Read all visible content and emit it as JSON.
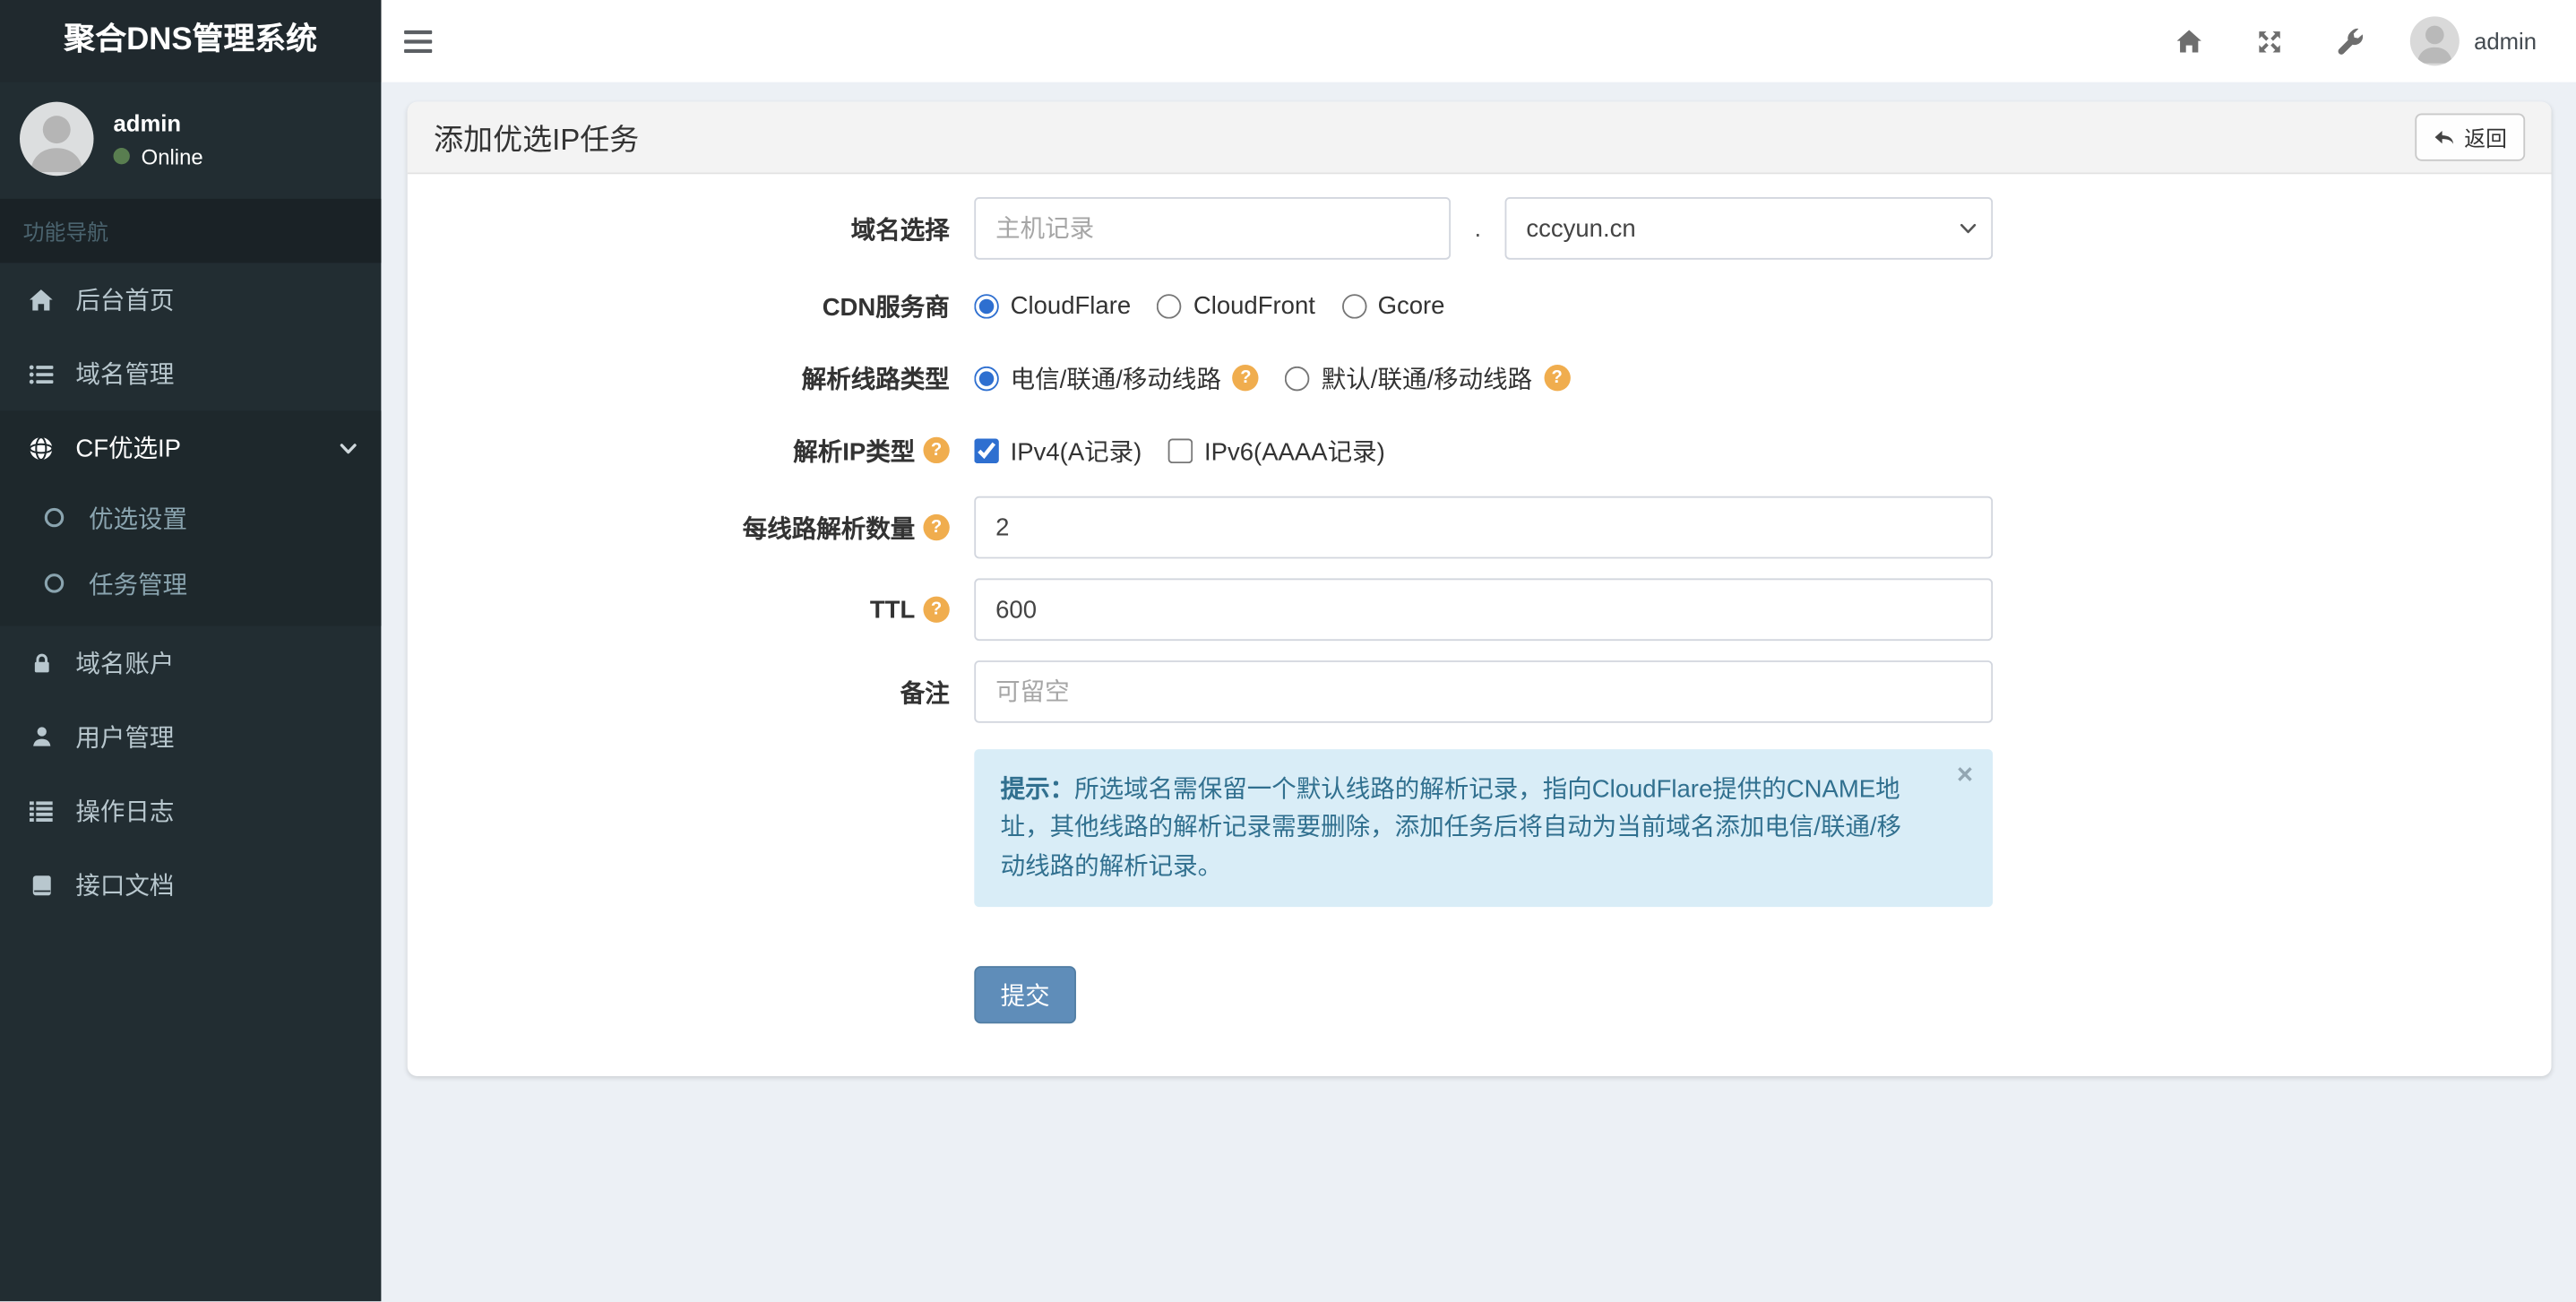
{
  "app": {
    "brand": "聚合DNS管理系统"
  },
  "user_panel": {
    "name": "admin",
    "status": "Online"
  },
  "navbar": {
    "username": "admin"
  },
  "sidebar": {
    "section_header": "功能导航",
    "menu": [
      {
        "label": "后台首页"
      },
      {
        "label": "域名管理"
      },
      {
        "label": "CF优选IP",
        "children": [
          {
            "label": "优选设置"
          },
          {
            "label": "任务管理"
          }
        ]
      },
      {
        "label": "域名账户"
      },
      {
        "label": "用户管理"
      },
      {
        "label": "操作日志"
      },
      {
        "label": "接口文档"
      }
    ]
  },
  "panel": {
    "title": "添加优选IP任务",
    "back_label": "返回"
  },
  "form": {
    "domain": {
      "label": "域名选择",
      "host_placeholder": "主机记录",
      "separator": ".",
      "selected_domain": "cccyun.cn"
    },
    "cdn": {
      "label": "CDN服务商",
      "options": [
        "CloudFlare",
        "CloudFront",
        "Gcore"
      ],
      "selected": "CloudFlare"
    },
    "line_type": {
      "label": "解析线路类型",
      "options": [
        "电信/联通/移动线路",
        "默认/联通/移动线路"
      ],
      "selected": "电信/联通/移动线路"
    },
    "ip_type": {
      "label": "解析IP类型",
      "options": [
        "IPv4(A记录)",
        "IPv6(AAAA记录)"
      ],
      "checked": [
        "IPv4(A记录)"
      ]
    },
    "per_line_count": {
      "label": "每线路解析数量",
      "value": "2"
    },
    "ttl": {
      "label": "TTL",
      "value": "600"
    },
    "remark": {
      "label": "备注",
      "placeholder": "可留空"
    },
    "tip": {
      "prefix": "提示：",
      "text": "所选域名需保留一个默认线路的解析记录，指向CloudFlare提供的CNAME地址，其他线路的解析记录需要删除，添加任务后将自动为当前域名添加电信/联通/移动线路的解析记录。",
      "close": "×"
    },
    "submit_label": "提交"
  },
  "icons": {
    "question_mark": "?"
  },
  "colors": {
    "sidebar_bg": "#222d32",
    "sidebar_active_bg": "#1e282c",
    "content_bg": "#ecf0f5",
    "accent_blue": "#2e6fd0",
    "help_orange": "#f0ad4e",
    "tip_bg": "#d9edf7",
    "tip_text": "#31708f",
    "submit_blue": "#5f8db9",
    "online_green": "#597e50"
  }
}
